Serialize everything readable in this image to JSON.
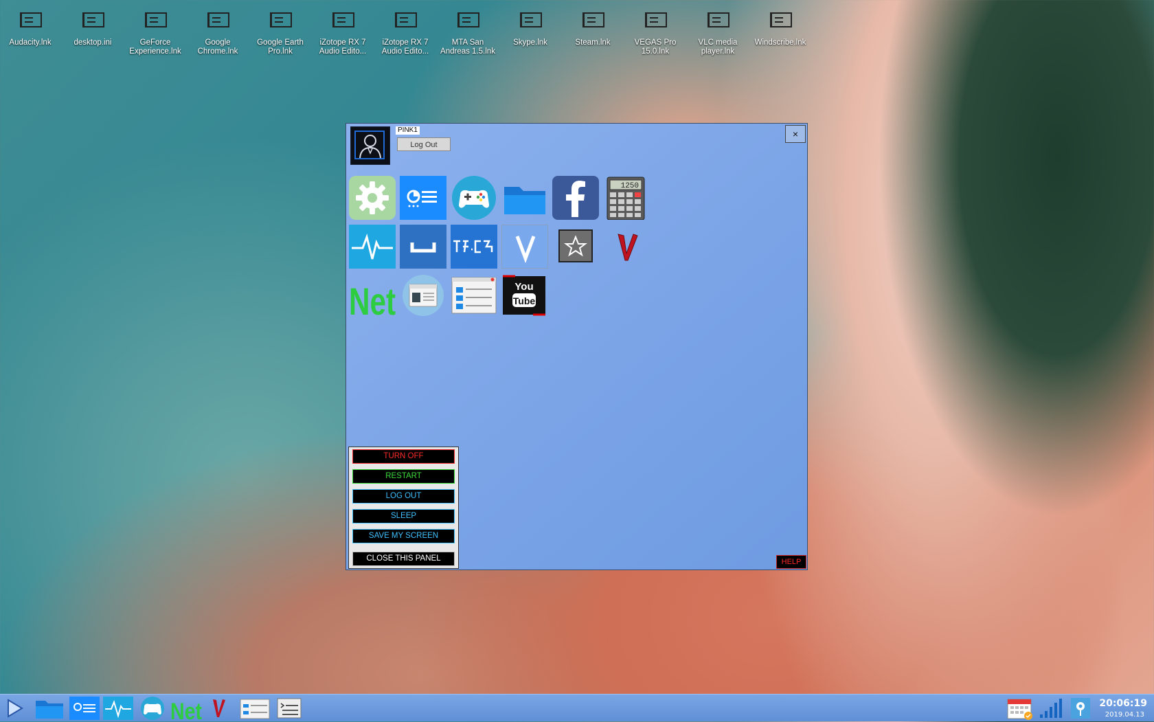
{
  "desktop": {
    "icons": [
      {
        "label": "Audacity.lnk"
      },
      {
        "label": "desktop.ini"
      },
      {
        "label": "GeForce Experience.lnk"
      },
      {
        "label": "Google Chrome.lnk"
      },
      {
        "label": "Google Earth Pro.lnk"
      },
      {
        "label": "iZotope RX 7 Audio Edito..."
      },
      {
        "label": "iZotope RX 7 Audio Edito..."
      },
      {
        "label": "MTA San Andreas 1.5.lnk"
      },
      {
        "label": "Skype.lnk"
      },
      {
        "label": "Steam.lnk"
      },
      {
        "label": "VEGAS Pro 15.0.lnk"
      },
      {
        "label": "VLC media player.lnk"
      },
      {
        "label": "Windscribe.lnk"
      }
    ]
  },
  "panel": {
    "user": "PINK1",
    "logout_label": "Log Out",
    "close_label": "×",
    "apps": [
      {
        "icon": "settings-gear-icon"
      },
      {
        "icon": "dashboard-list-icon"
      },
      {
        "icon": "gamepad-icon"
      },
      {
        "icon": "folder-icon"
      },
      {
        "icon": "facebook-icon"
      },
      {
        "icon": "calculator-icon"
      },
      {
        "icon": "pulse-monitor-icon"
      },
      {
        "icon": "spacebar-icon"
      },
      {
        "icon": "text-tool-icon"
      },
      {
        "icon": "v-letter-icon"
      },
      {
        "icon": "star-icon"
      },
      {
        "icon": "v-red-icon"
      },
      {
        "icon": "net-icon"
      },
      {
        "icon": "browser-window-icon"
      },
      {
        "icon": "list-window-icon"
      },
      {
        "icon": "youtube-icon"
      }
    ],
    "calculator_display": "1250",
    "net_label": "Net",
    "youtube_you": "You",
    "youtube_tube": "Tube",
    "power": {
      "turn_off": "TURN OFF",
      "restart": "RESTART",
      "log_out": "LOG OUT",
      "sleep": "SLEEP",
      "save_screen": "SAVE MY SCREEN",
      "close_panel": "CLOSE THIS PANEL"
    },
    "help_label": "HELP"
  },
  "taskbar": {
    "net_label": "Net",
    "time": "20:06:19",
    "date": "2019.04.13"
  }
}
